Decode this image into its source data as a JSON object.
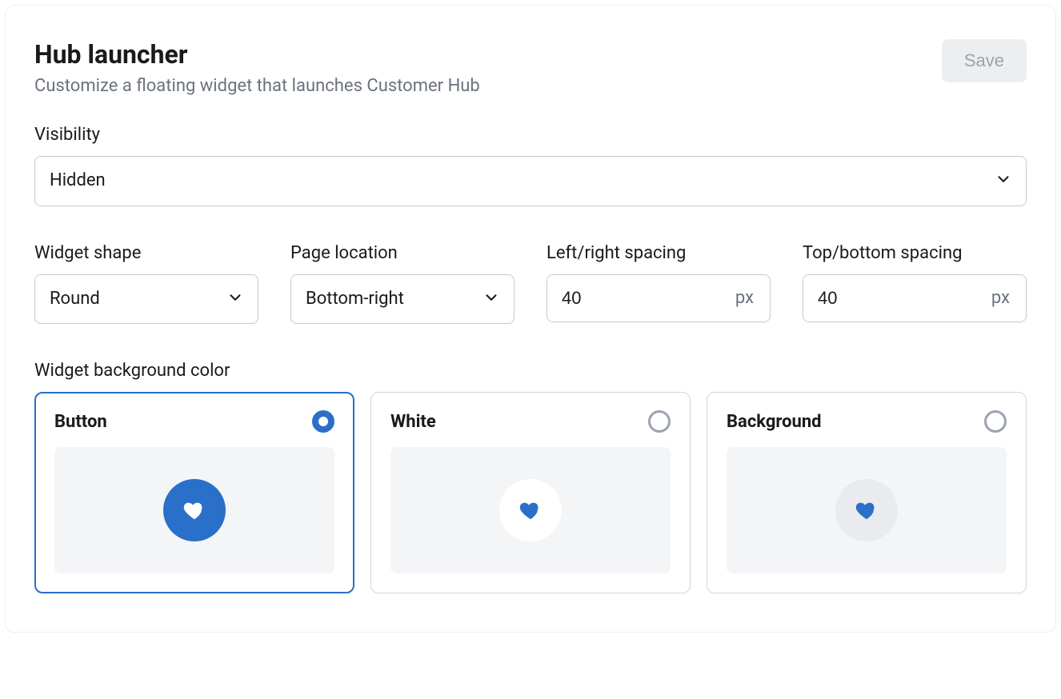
{
  "header": {
    "title": "Hub launcher",
    "subtitle": "Customize a floating widget that launches Customer Hub",
    "save_label": "Save"
  },
  "visibility": {
    "label": "Visibility",
    "value": "Hidden"
  },
  "widget_shape": {
    "label": "Widget shape",
    "value": "Round"
  },
  "page_location": {
    "label": "Page location",
    "value": "Bottom-right"
  },
  "lr_spacing": {
    "label": "Left/right spacing",
    "value": "40",
    "unit": "px"
  },
  "tb_spacing": {
    "label": "Top/bottom spacing",
    "value": "40",
    "unit": "px"
  },
  "bg_color": {
    "label": "Widget background color",
    "options": [
      {
        "label": "Button",
        "selected": true
      },
      {
        "label": "White",
        "selected": false
      },
      {
        "label": "Background",
        "selected": false
      }
    ]
  },
  "colors": {
    "accent": "#2a6fc9"
  }
}
